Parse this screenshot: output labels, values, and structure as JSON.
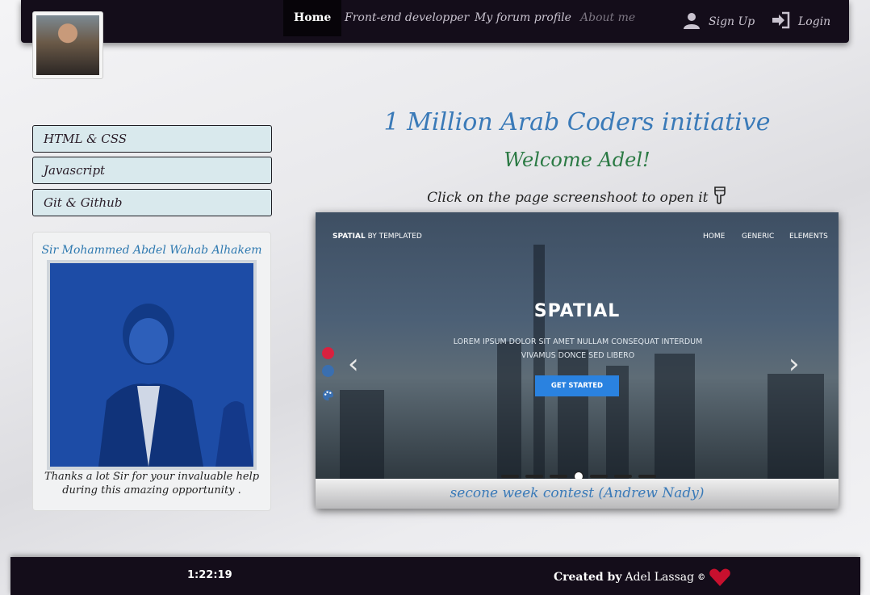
{
  "navbar": {
    "items": [
      {
        "label": "Home",
        "state": "active"
      },
      {
        "label": "Front-end developper",
        "state": "normal"
      },
      {
        "label": "My forum profile",
        "state": "normal"
      },
      {
        "label": "About me",
        "state": "muted"
      }
    ],
    "sign_up": "Sign Up",
    "login": "Login",
    "sign_up_icon": "user-icon",
    "login_icon": "sign-in-icon"
  },
  "sidebar": {
    "items": [
      "HTML & CSS",
      "Javascript",
      "Git & Github"
    ]
  },
  "card": {
    "title": "Sir Mohammed Abdel Wahab Alhakem",
    "caption": "Thanks a lot Sir for your invaluable help during this amazing opportunity ."
  },
  "main": {
    "title": "1 Million Arab Coders initiative",
    "welcome": "Welcome Adel!",
    "hint": "Click on the page screenshoot to open it",
    "hint_icon": "hand-point-down-icon"
  },
  "carousel": {
    "slide": {
      "brand_bold": "SPATIAL",
      "brand_rest": " BY TEMPLATED",
      "nav": [
        "HOME",
        "GENERIC",
        "ELEMENTS"
      ],
      "headline": "SPATIAL",
      "lorem": "LOREM IPSUM DOLOR SIT AMET NULLAM CONSEQUAT INTERDUM VIVAMUS DONCE SED LIBERO",
      "cta": "GET STARTED"
    },
    "prev_icon": "chevron-left-icon",
    "next_icon": "chevron-right-icon",
    "indicator_count": 7,
    "active_indicator": 4,
    "caption": "secone week contest (Andrew Nady)",
    "swatch_colors": [
      "#d9213f",
      "#3a6fb0"
    ],
    "palette_icon": "palette-icon"
  },
  "footer": {
    "clock": "1:22:19",
    "credit_prefix": "Created by",
    "credit_name": "Adel Lassag",
    "copyright": "©",
    "heart_icon": "heart-icon"
  }
}
